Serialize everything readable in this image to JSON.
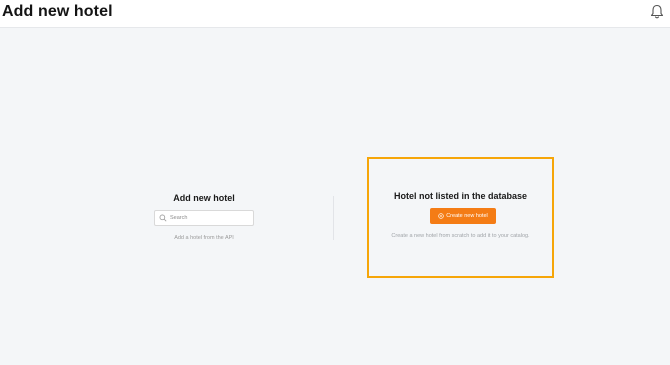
{
  "header": {
    "title": "Add new hotel",
    "bell_icon": "bell-icon"
  },
  "left_panel": {
    "title": "Add new hotel",
    "search": {
      "placeholder": "Search",
      "value": ""
    },
    "caption": "Add a hotel from the API"
  },
  "right_panel": {
    "title": "Hotel not listed in the database",
    "create_button_label": "Create new hotel",
    "create_button_icon": "plus-circle-icon",
    "caption": "Create a new hotel from scratch to add it to your catalog."
  },
  "colors": {
    "accent": "#f47c15",
    "highlight_border": "#f6a609",
    "background": "#f4f6f8"
  }
}
